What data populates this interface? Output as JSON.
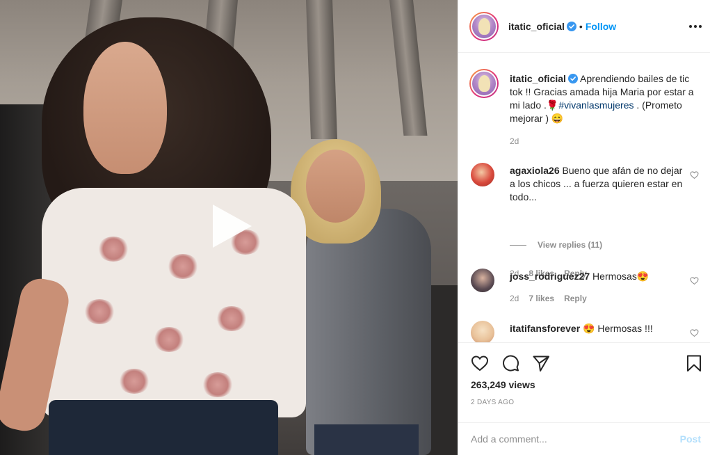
{
  "post": {
    "username": "itatic_oficial",
    "verified": true,
    "follow_label": "Follow",
    "separator": "•",
    "caption": {
      "text_before": "Aprendiendo bailes de tic tok !! Gracias amada hija Maria por estar a mi lado .🌹",
      "hashtag": "#vivanlasmujeres",
      "text_after": " . (Prometo mejorar ) 😄",
      "time": "2d"
    },
    "views": "263,249 views",
    "date": "2 DAYS AGO"
  },
  "comments": [
    {
      "username": "agaxiola26",
      "text": "Bueno que afán de no dejar a los chicos ... a fuerza quieren estar en todo...",
      "time": "2d",
      "likes": "8 likes",
      "reply_label": "Reply",
      "view_replies": "View replies (11)",
      "avatar_color": "#d94a3d"
    },
    {
      "username": "joss_rodriguez27",
      "text": "Hermosas😍",
      "time": "2d",
      "likes": "7 likes",
      "reply_label": "Reply",
      "avatar_color": "#5a4a52"
    },
    {
      "username": "itatifansforever",
      "text": "😍 Hermosas !!!",
      "avatar_color": "#e9c29a"
    }
  ],
  "add_comment": {
    "placeholder": "Add a comment...",
    "post_label": "Post"
  },
  "colors": {
    "link_blue": "#0095f6",
    "post_disabled": "#b2dffc",
    "muted": "#8e8e8e"
  },
  "icons": [
    "play-icon",
    "verified-icon",
    "more-icon",
    "heart-icon",
    "comment-icon",
    "share-icon",
    "bookmark-icon"
  ]
}
